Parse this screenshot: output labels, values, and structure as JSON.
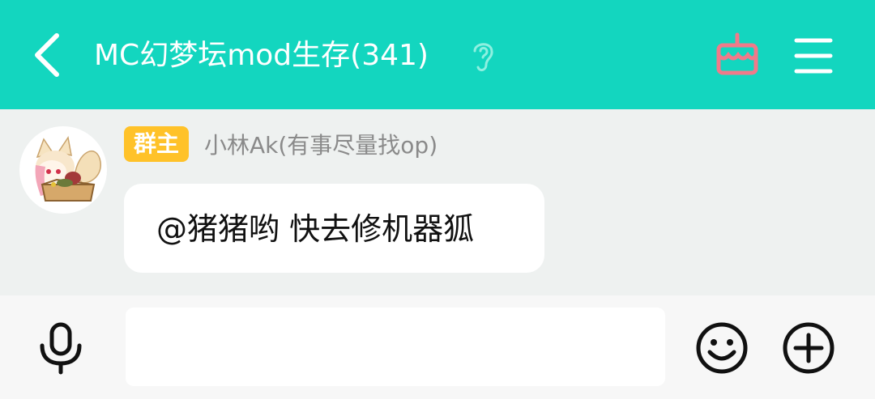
{
  "header": {
    "title": "MC幻梦坛mod生存(341)",
    "back_icon": "chevron-left-icon",
    "ear_icon": "ear-icon",
    "cake_icon": "birthday-cake-icon",
    "menu_icon": "hamburger-menu-icon",
    "bg_color": "#13d6bf"
  },
  "message": {
    "role_badge": "群主",
    "sender": "小林Ak(有事尽量找op)",
    "text": "@猪猪哟 快去修机器狐",
    "avatar_icon": "fox-girl-avatar"
  },
  "inputbar": {
    "mic_icon": "microphone-icon",
    "input_value": "",
    "emoji_icon": "smiley-icon",
    "plus_icon": "plus-circle-icon"
  },
  "colors": {
    "accent": "#13d6bf",
    "badge": "#ffc229",
    "cake": "#f07a8a"
  }
}
